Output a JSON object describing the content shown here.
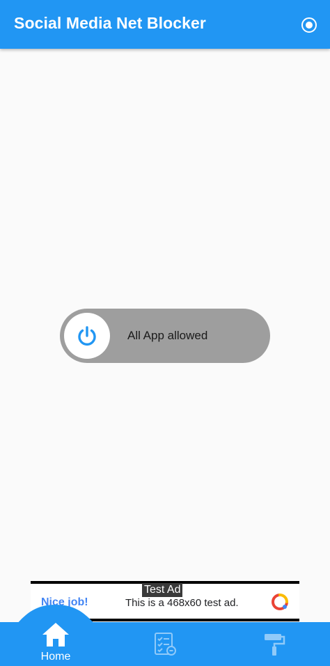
{
  "app_bar": {
    "title": "Social Media Net Blocker",
    "action_icon": "record-icon"
  },
  "toggle": {
    "label": "All App allowed",
    "state": "off",
    "icon": "power-icon",
    "track_color": "#9e9e9e",
    "icon_color": "#2196f3"
  },
  "ad": {
    "tag": "Test Ad",
    "headline": "Nice job!",
    "text": "This is a 468x60 test ad.",
    "icon": "adchoices-logo-icon"
  },
  "nav": {
    "items": [
      {
        "label": "Home",
        "icon": "home-icon",
        "active": true
      },
      {
        "label": "",
        "icon": "checklist-icon",
        "active": false
      },
      {
        "label": "",
        "icon": "paint-roller-icon",
        "active": false
      }
    ]
  },
  "colors": {
    "primary": "#2196f3",
    "background": "#fafafa",
    "ad_headline": "#4285f4"
  }
}
